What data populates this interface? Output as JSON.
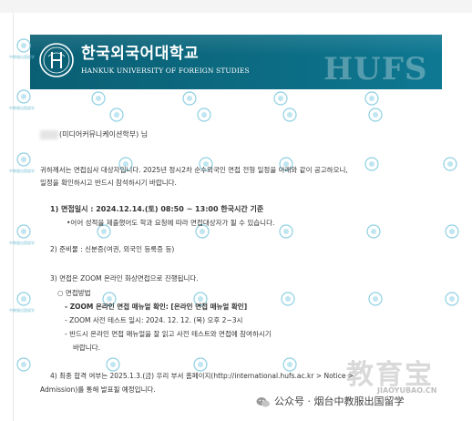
{
  "header": {
    "university_name_ko": "한국외국어대학교",
    "university_name_en": "HANKUK UNIVERSITY OF FOREIGN STUDIES",
    "banner_watermark": "HUFS",
    "seal_icon": "hufs-seal-icon"
  },
  "letter": {
    "greeting": "(미디어커뮤니케이션학부) 님",
    "intro_1": "귀하께서는 면접심사 대상자입니다. 2025년 정시2차 순수외국인 면접 전형 일정을 아래와 같이 공고하오니,",
    "intro_2": "일정을 확인하시고 반드시 참석하시기 바랍니다.",
    "item1_title": "1) 면접일시 : 2024.12.14.(토) 08:50 ~ 13:00 한국시간 기준",
    "item1_note": "•어어 성적을 제출했어도 학과 요청에 따라 면접대상자가 될 수 있습니다.",
    "item2": "2) 준비물 : 신분증(여권, 외국인 등록증 등)",
    "item3": "3) 면접은 ZOOM 온라인 화상면접으로 진행됩니다.",
    "item3_method": "○ 면접방법",
    "item3_sub1": "- ZOOM 온라인 면접 매뉴얼 확인: [온라인 면접 매뉴얼 확인]",
    "item3_sub2": "- ZOOM 사전 테스트 일시: 2024. 12. 12. (목) 오후 2~3시",
    "item3_sub3a": "- 반드시 온라인 면접 매뉴얼을 잘 읽고 사전 테스트와 면접에 참여하시기",
    "item3_sub3b": "바랍니다.",
    "item4a": "4) 최종 합격 여부는 2025.1.3.(금) 우리 부서 홈페이지(http://international.hufs.ac.kr > Notice >",
    "item4b": "Admission)를 통해 발표될 예정입니다."
  },
  "watermarks": {
    "small_label": "中教服出国留学",
    "repeat_icon": "jsfwcg-watermark-icon",
    "corner_big": "教育宝",
    "corner_site": "JIAOYUBAO.CN",
    "wechat_text": "公众号 · 烟台中教服出国留学",
    "wechat_icon": "wechat-icon"
  }
}
